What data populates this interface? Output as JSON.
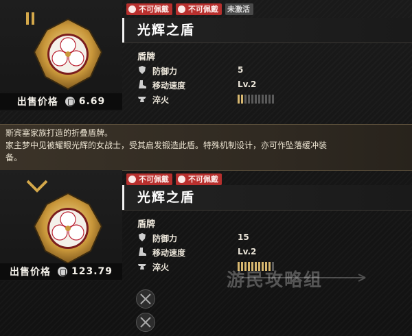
{
  "item1": {
    "marker": "pause-icon",
    "badges": [
      {
        "label": "不可佩戴",
        "style": "red",
        "icon": "figure-icon"
      },
      {
        "label": "不可佩戴",
        "style": "red",
        "icon": "figure-icon"
      },
      {
        "label": "未激活",
        "style": "gray"
      }
    ],
    "name": "光辉之盾",
    "category": "盾牌",
    "price_label": "出售价格",
    "price": "6.69",
    "stats": [
      {
        "label": "防御力",
        "value": "5",
        "icon": "shield-small-icon"
      },
      {
        "label": "移动速度",
        "value": "Lv.2",
        "icon": "boot-icon"
      },
      {
        "label": "淬火",
        "icon": "anvil-icon"
      }
    ],
    "temper_filled": 2,
    "temper_total": 11
  },
  "description": {
    "line1": "斯宾塞家族打造的折叠盾牌。",
    "line2": "家主梦中见被耀眼光辉的女战士，受其启发锻造此盾。特殊机制设计，亦可作坠落缓冲装",
    "line3": "备。"
  },
  "item2": {
    "marker": "chevron-down-icon",
    "badges": [
      {
        "label": "不可佩戴",
        "style": "red",
        "icon": "figure-icon"
      },
      {
        "label": "不可佩戴",
        "style": "red",
        "icon": "figure-icon"
      }
    ],
    "name": "光辉之盾",
    "category": "盾牌",
    "price_label": "出售价格",
    "price": "123.79",
    "stats": [
      {
        "label": "防御力",
        "value": "15",
        "icon": "shield-small-icon"
      },
      {
        "label": "移动速度",
        "value": "Lv.2",
        "icon": "boot-icon"
      },
      {
        "label": "淬火",
        "icon": "anvil-icon"
      }
    ],
    "temper_filled": 10,
    "temper_total": 11,
    "upgrade_slots": [
      "crossed-swords-icon",
      "crossed-swords-icon"
    ]
  },
  "watermark": "游民攻略组",
  "colors": {
    "gold": "#d4a84a",
    "badge_red": "#b8302e",
    "badge_gray": "#4a4a4a",
    "desc_bg": "#342d24"
  }
}
